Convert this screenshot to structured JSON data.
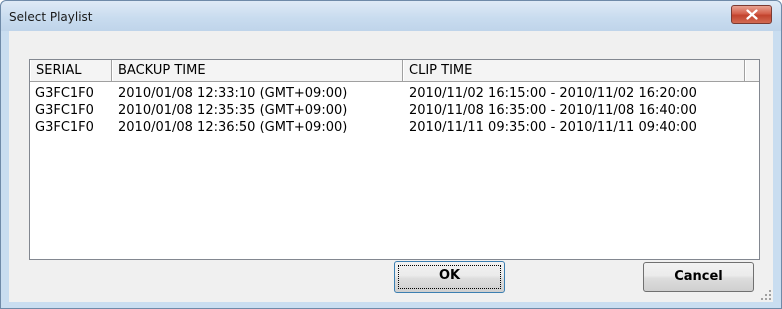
{
  "window": {
    "title": "Select Playlist"
  },
  "list": {
    "columns": [
      "SERIAL",
      "BACKUP TIME",
      "CLIP TIME",
      ""
    ],
    "rows": [
      {
        "serial": "G3FC1F0",
        "backup_time": "2010/01/08 12:33:10 (GMT+09:00)",
        "clip_time": "2010/11/02 16:15:00 - 2010/11/02 16:20:00"
      },
      {
        "serial": "G3FC1F0",
        "backup_time": "2010/01/08 12:35:35 (GMT+09:00)",
        "clip_time": "2010/11/08 16:35:00 - 2010/11/08 16:40:00"
      },
      {
        "serial": "G3FC1F0",
        "backup_time": "2010/01/08 12:36:50 (GMT+09:00)",
        "clip_time": "2010/11/11 09:35:00 - 2010/11/11 09:40:00"
      }
    ]
  },
  "buttons": {
    "ok_label": "OK",
    "cancel_label": "Cancel"
  },
  "icons": {
    "close": "close-icon"
  },
  "colors": {
    "close_button": "#c2432d",
    "frame": "#c9ddf0"
  }
}
